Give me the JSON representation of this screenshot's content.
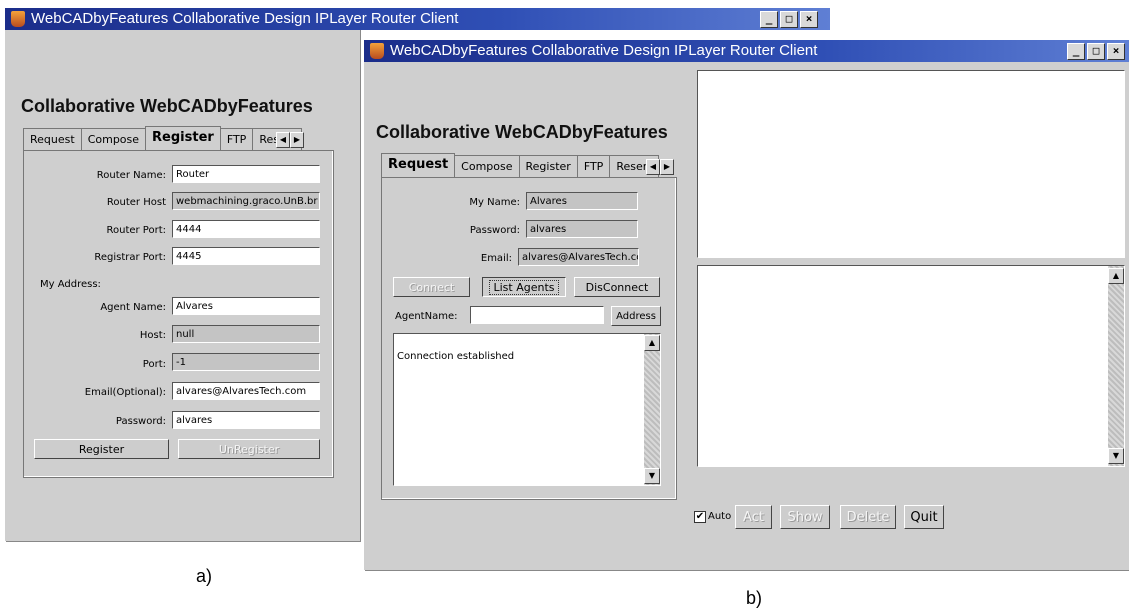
{
  "window_a": {
    "title": "WebCADbyFeatures Collaborative Design IPLayer Router Client",
    "heading": "Collaborative WebCADbyFeatures",
    "tabs": [
      "Request",
      "Compose",
      "Register",
      "FTP",
      "Reserv"
    ],
    "selected_tab": "Register",
    "form": {
      "router_name_label": "Router Name:",
      "router_name_value": "Router",
      "router_host_label": "Router Host",
      "router_host_value": "webmachining.graco.UnB.br",
      "router_port_label": "Router Port:",
      "router_port_value": "4444",
      "registrar_port_label": "Registrar Port:",
      "registrar_port_value": "4445",
      "my_address_label": "My Address:",
      "agent_name_label": "Agent Name:",
      "agent_name_value": "Alvares",
      "host_label": "Host:",
      "host_value": "null",
      "port_label": "Port:",
      "port_value": "-1",
      "email_label": "Email(Optional):",
      "email_value": "alvares@AlvaresTech.com",
      "password_label": "Password:",
      "password_value": "alvares",
      "register_button": "Register",
      "unregister_button": "UnRegister"
    }
  },
  "window_b": {
    "title": "WebCADbyFeatures Collaborative Design IPLayer Router Client",
    "heading": "Collaborative WebCADbyFeatures",
    "tabs": [
      "Request",
      "Compose",
      "Register",
      "FTP",
      "Reserv"
    ],
    "selected_tab": "Request",
    "form": {
      "my_name_label": "My Name:",
      "my_name_value": "Alvares",
      "password_label": "Password:",
      "password_value": "alvares",
      "email_label": "Email:",
      "email_value": "alvares@AlvaresTech.com",
      "connect_button": "Connect",
      "list_agents_button": "List Agents",
      "disconnect_button": "DisConnect",
      "agent_name_label": "AgentName:",
      "agent_name_value": "",
      "address_button": "Address",
      "log_text": "Connection established"
    },
    "bottom": {
      "auto_label": "Auto",
      "auto_checked": true,
      "act_button": "Act",
      "show_button": "Show",
      "delete_button": "Delete",
      "quit_button": "Quit"
    }
  },
  "captions": {
    "a": "a)",
    "b": "b)"
  },
  "colors": {
    "titlebar": "#1b2d8a",
    "window_bg": "#cfcfcf"
  }
}
